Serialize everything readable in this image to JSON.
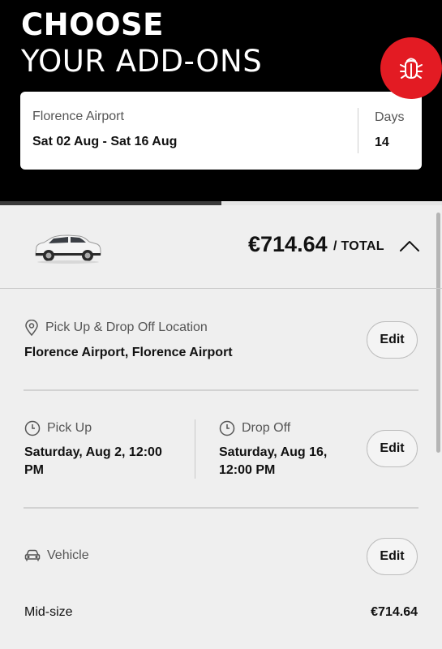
{
  "header": {
    "title_line1": "CHOOSE",
    "title_line2": "YOUR ADD-ONS"
  },
  "bug_button": {
    "icon": "bug-icon",
    "color": "#e31b23"
  },
  "summary": {
    "location": "Florence Airport",
    "dates": "Sat 02 Aug - Sat 16 Aug",
    "days_label": "Days",
    "days_value": "14"
  },
  "progress": {
    "fraction": 0.5
  },
  "total": {
    "price": "€714.64",
    "per_label": "/ TOTAL",
    "collapse_icon": "chevron-up-icon",
    "car_icon": "suv-car-image"
  },
  "location_section": {
    "label": "Pick Up & Drop Off Location",
    "icon": "location-pin-icon",
    "value": "Florence Airport, Florence Airport",
    "edit_label": "Edit"
  },
  "time_section": {
    "pickup_label": "Pick Up",
    "pickup_value": "Saturday, Aug 2, 12:00 PM",
    "dropoff_label": "Drop Off",
    "dropoff_value": "Saturday, Aug 16, 12:00 PM",
    "clock_icon": "clock-icon",
    "edit_label": "Edit"
  },
  "vehicle_section": {
    "label": "Vehicle",
    "icon": "car-icon",
    "edit_label": "Edit",
    "class_name": "Mid-size",
    "class_price": "€714.64"
  }
}
